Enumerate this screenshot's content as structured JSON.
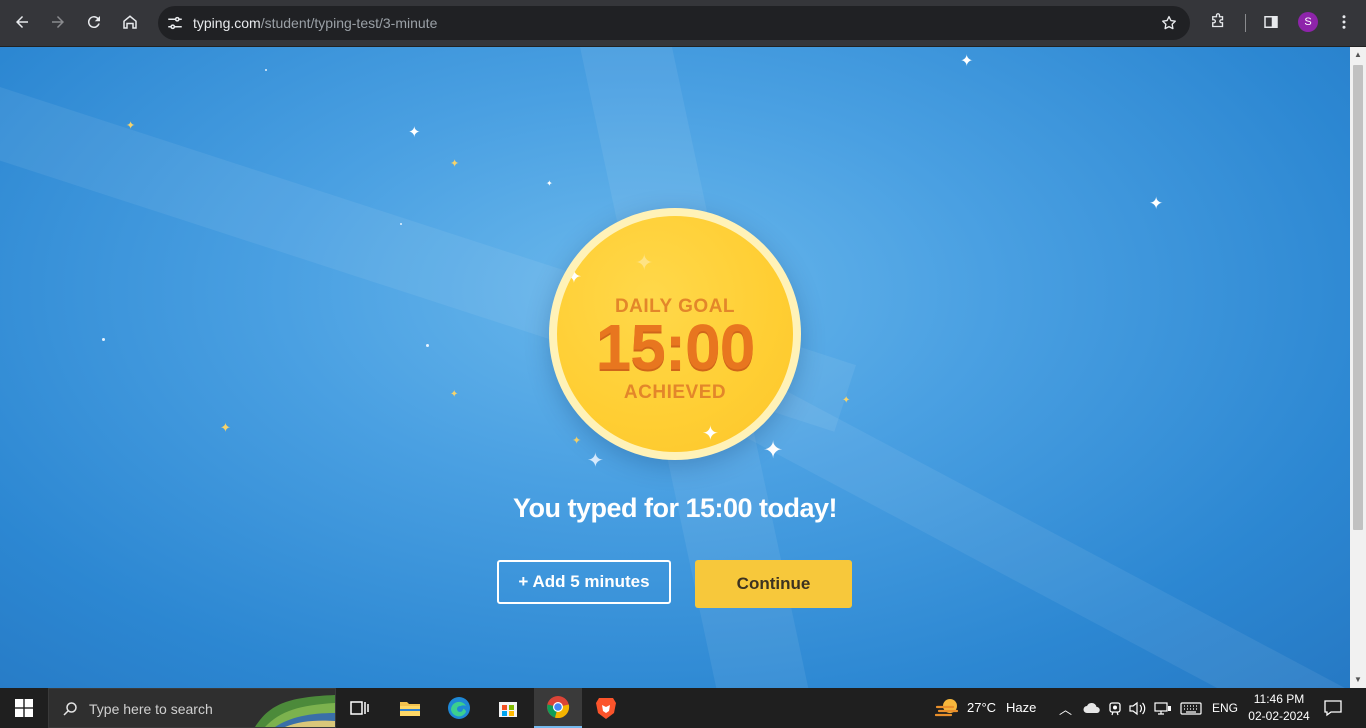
{
  "browser": {
    "url_host": "typing.com",
    "url_path": "/student/typing-test/3-minute",
    "profile_initial": "S"
  },
  "goal": {
    "top_label": "DAILY GOAL",
    "time": "15:00",
    "bottom_label": "ACHIEVED",
    "headline": "You typed for 15:00 today!"
  },
  "actions": {
    "add_label": "+ Add 5 minutes",
    "continue_label": "Continue"
  },
  "taskbar": {
    "search_placeholder": "Type here to search",
    "temperature": "27°C",
    "weather": "Haze",
    "language": "ENG",
    "time": "11:46 PM",
    "date": "02-02-2024"
  },
  "colors": {
    "accent_button": "#f7c83b",
    "medal": "#ffce33",
    "medal_text": "#e8761f"
  }
}
